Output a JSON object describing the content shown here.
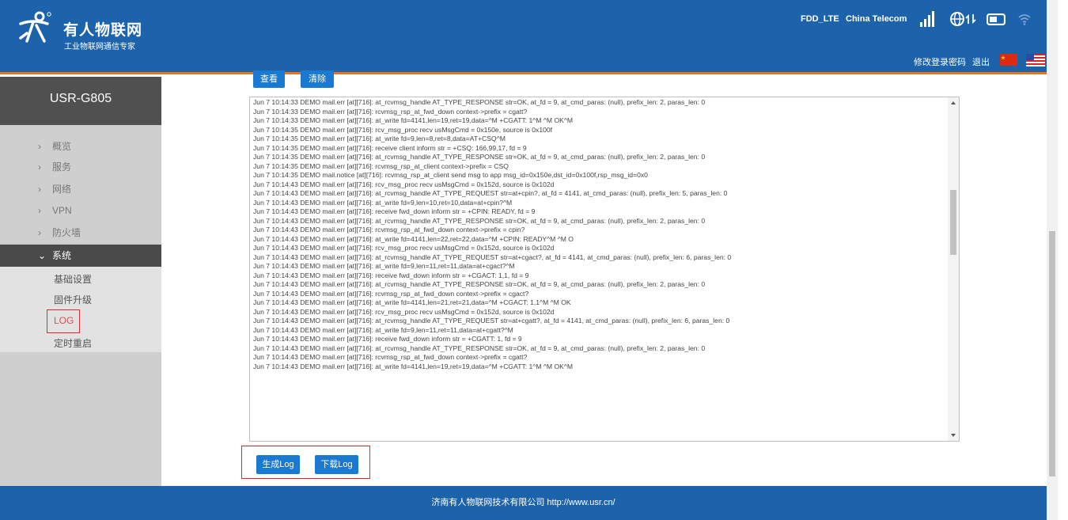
{
  "brand": {
    "title": "有人物联网",
    "subtitle": "工业物联网通信专家"
  },
  "status": {
    "network_type": "FDD_LTE",
    "carrier": "China Telecom"
  },
  "header_links": {
    "change_password": "修改登录密码",
    "logout": "退出"
  },
  "colors": {
    "header_bg": "#1d63ac",
    "accent_orange": "#e8731a",
    "button_blue": "#1a79d0",
    "highlight_red": "#e0262e"
  },
  "sidebar": {
    "device_name": "USR-G805",
    "menu": [
      {
        "label": "概览",
        "chevron": "›"
      },
      {
        "label": "服务",
        "chevron": "›"
      },
      {
        "label": "网络",
        "chevron": "›"
      },
      {
        "label": "VPN",
        "chevron": "›"
      },
      {
        "label": "防火墙",
        "chevron": "›"
      },
      {
        "label": "系统",
        "chevron": "⌄"
      }
    ],
    "submenu": [
      "基础设置",
      "固件升级",
      "LOG",
      "定时重启"
    ]
  },
  "top_buttons": {
    "view": "查看",
    "clear": "清除"
  },
  "log_lines": [
    "Jun  7 10:14:33 DEMO mail.err [at][716]: at_rcvmsg_handle AT_TYPE_RESPONSE str=OK, at_fd = 9, at_cmd_paras: (null), prefix_len: 2, paras_len: 0",
    "Jun  7 10:14:33 DEMO mail.err [at][716]: rcvmsg_rsp_at_fwd_down context->prefix = cgatt?",
    "Jun  7 10:14:33 DEMO mail.err [at][716]: at_write fd=4141,len=19,ret=19,data=^M +CGATT: 1^M ^M OK^M",
    "Jun  7 10:14:35 DEMO mail.err [at][716]: rcv_msg_proc recv usMsgCmd = 0x150e, source is 0x100f",
    "Jun  7 10:14:35 DEMO mail.err [at][716]: at_write fd=9,len=8,ret=8,data=AT+CSQ^M",
    "Jun  7 10:14:35 DEMO mail.err [at][716]: receive client inform str = +CSQ: 166,99,17, fd = 9",
    "Jun  7 10:14:35 DEMO mail.err [at][716]: at_rcvmsg_handle AT_TYPE_RESPONSE str=OK, at_fd = 9, at_cmd_paras: (null), prefix_len: 2, paras_len: 0",
    "Jun  7 10:14:35 DEMO mail.err [at][716]: rcvmsg_rsp_at_client context->prefix = CSQ",
    "Jun  7 10:14:35 DEMO mail.notice [at][716]: rcvmsg_rsp_at_client send msg to app msg_id=0x150e,dst_id=0x100f,rsp_msg_id=0x0",
    "Jun  7 10:14:43 DEMO mail.err [at][716]: rcv_msg_proc recv usMsgCmd = 0x152d, source is 0x102d",
    "Jun  7 10:14:43 DEMO mail.err [at][716]: at_rcvmsg_handle AT_TYPE_REQUEST str=at+cpin?, at_fd = 4141, at_cmd_paras: (null), prefix_len: 5, paras_len: 0",
    "Jun  7 10:14:43 DEMO mail.err [at][716]: at_write fd=9,len=10,ret=10,data=at+cpin?^M",
    "Jun  7 10:14:43 DEMO mail.err [at][716]: receive fwd_down inform str = +CPIN: READY, fd = 9",
    "Jun  7 10:14:43 DEMO mail.err [at][716]: at_rcvmsg_handle AT_TYPE_RESPONSE str=OK, at_fd = 9, at_cmd_paras: (null), prefix_len: 2, paras_len: 0",
    "Jun  7 10:14:43 DEMO mail.err [at][716]: rcvmsg_rsp_at_fwd_down context->prefix = cpin?",
    "Jun  7 10:14:43 DEMO mail.err [at][716]: at_write fd=4141,len=22,ret=22,data=^M +CPIN: READY^M ^M O",
    "Jun  7 10:14:43 DEMO mail.err [at][716]: rcv_msg_proc recv usMsgCmd = 0x152d, source is 0x102d",
    "Jun  7 10:14:43 DEMO mail.err [at][716]: at_rcvmsg_handle AT_TYPE_REQUEST str=at+cgact?, at_fd = 4141, at_cmd_paras: (null), prefix_len: 6, paras_len: 0",
    "Jun  7 10:14:43 DEMO mail.err [at][716]: at_write fd=9,len=11,ret=11,data=at+cgact?^M",
    "Jun  7 10:14:43 DEMO mail.err [at][716]: receive fwd_down inform str = +CGACT: 1,1, fd = 9",
    "Jun  7 10:14:43 DEMO mail.err [at][716]: at_rcvmsg_handle AT_TYPE_RESPONSE str=OK, at_fd = 9, at_cmd_paras: (null), prefix_len: 2, paras_len: 0",
    "Jun  7 10:14:43 DEMO mail.err [at][716]: rcvmsg_rsp_at_fwd_down context->prefix = cgact?",
    "Jun  7 10:14:43 DEMO mail.err [at][716]: at_write fd=4141,len=21,ret=21,data=^M +CGACT: 1,1^M ^M OK",
    "Jun  7 10:14:43 DEMO mail.err [at][716]: rcv_msg_proc recv usMsgCmd = 0x152d, source is 0x102d",
    "Jun  7 10:14:43 DEMO mail.err [at][716]: at_rcvmsg_handle AT_TYPE_REQUEST str=at+cgatt?, at_fd = 4141, at_cmd_paras: (null), prefix_len: 6, paras_len: 0",
    "Jun  7 10:14:43 DEMO mail.err [at][716]: at_write fd=9,len=11,ret=11,data=at+cgatt?^M",
    "Jun  7 10:14:43 DEMO mail.err [at][716]: receive fwd_down inform str = +CGATT: 1, fd = 9",
    "Jun  7 10:14:43 DEMO mail.err [at][716]: at_rcvmsg_handle AT_TYPE_RESPONSE str=OK, at_fd = 9, at_cmd_paras: (null), prefix_len: 2, paras_len: 0",
    "Jun  7 10:14:43 DEMO mail.err [at][716]: rcvmsg_rsp_at_fwd_down context->prefix = cgatt?",
    "Jun  7 10:14:43 DEMO mail.err [at][716]: at_write fd=4141,len=19,ret=19,data=^M +CGATT: 1^M ^M OK^M"
  ],
  "action_buttons": {
    "generate": "生成Log",
    "download": "下载Log"
  },
  "footer": {
    "text": "济南有人物联网技术有限公司  http://www.usr.cn/"
  },
  "icons": [
    "logo-person-icon",
    "signal-bars-icon",
    "globe-data-icon",
    "sim-card-icon",
    "wifi-off-icon",
    "china-flag-icon",
    "us-flag-icon"
  ]
}
